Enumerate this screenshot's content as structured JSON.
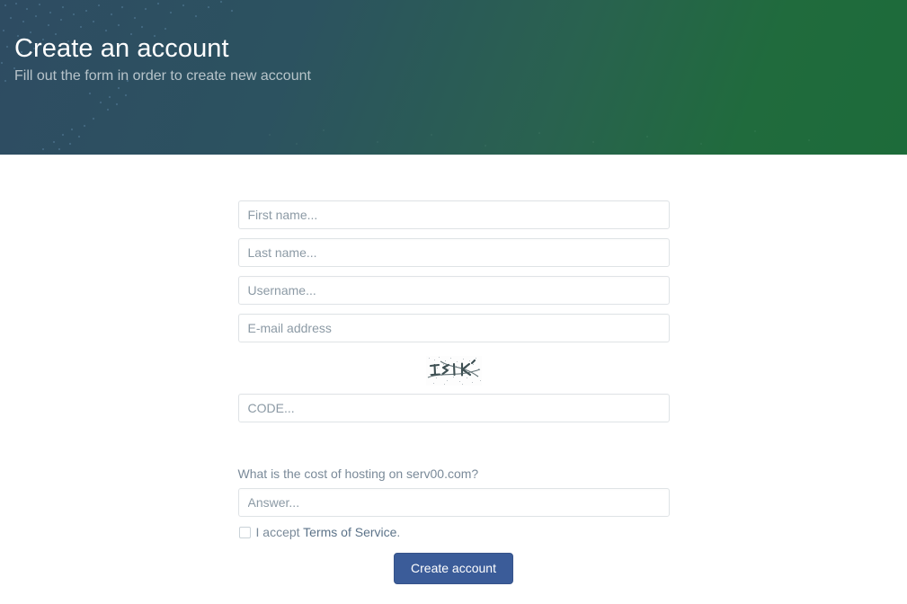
{
  "header": {
    "title": "Create an account",
    "subtitle": "Fill out the form in order to create new account",
    "gradient_start": "#2e4c62",
    "gradient_end": "#1d6b3a"
  },
  "form": {
    "fields": [
      {
        "name": "first-name",
        "placeholder": "First name...",
        "value": ""
      },
      {
        "name": "last-name",
        "placeholder": "Last name...",
        "value": ""
      },
      {
        "name": "username",
        "placeholder": "Username...",
        "value": ""
      },
      {
        "name": "email",
        "placeholder": "E-mail address",
        "value": ""
      }
    ],
    "captcha": {
      "icon": "captcha-image",
      "alt": "captcha"
    },
    "code": {
      "placeholder": "CODE...",
      "value": ""
    },
    "question": {
      "text": "What is the cost of hosting on serv00.com?",
      "answer_placeholder": "Answer...",
      "answer_value": ""
    },
    "terms": {
      "prefix": "I accept ",
      "link_label": "Terms of Service",
      "suffix": ".",
      "checked": false
    },
    "submit_label": "Create account",
    "submit_color": "#3b5c99"
  }
}
